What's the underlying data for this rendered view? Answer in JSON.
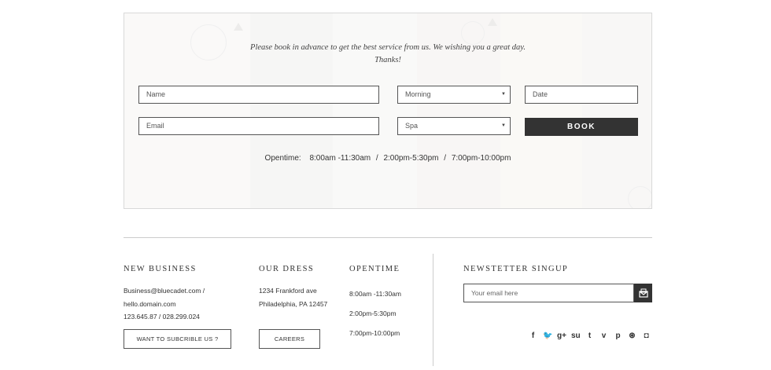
{
  "booking": {
    "intro_line1": "Please book in advance to get the best service from us. We wishing you a great day.",
    "intro_line2": "Thanks!",
    "name_placeholder": "Name",
    "email_placeholder": "Email",
    "time_value": "Morning",
    "service_value": "Spa",
    "date_placeholder": "Date",
    "book_label": "BOOK",
    "opentime_label": "Opentime:",
    "opentime_slots": [
      "8:00am -11:30am",
      "2:00pm-5:30pm",
      "7:00pm-10:00pm"
    ],
    "separator": "/"
  },
  "footer": {
    "business": {
      "title": "NEW BUSINESS",
      "lines": [
        "Business@bluecadet.com /",
        "hello.domain.com",
        "123.645.87 / 028.299.024"
      ],
      "button": "WANT TO SUBCRIBLE US ?"
    },
    "address": {
      "title": "OUR DRESS",
      "lines": [
        "1234 Frankford ave",
        "Philadelphia, PA 12457"
      ],
      "button": "CAREERS"
    },
    "opentime": {
      "title": "OPENTIME",
      "lines": [
        "8:00am -11:30am",
        "2:00pm-5:30pm",
        "7:00pm-10:00pm"
      ]
    },
    "newsletter": {
      "title": "NEWSTETTER SINGUP",
      "placeholder": "Your email here"
    },
    "socials": [
      {
        "name": "facebook-icon",
        "glyph": "f"
      },
      {
        "name": "twitter-icon",
        "glyph": "🐦"
      },
      {
        "name": "google-plus-icon",
        "glyph": "g+"
      },
      {
        "name": "stumbleupon-icon",
        "glyph": "su"
      },
      {
        "name": "tumblr-icon",
        "glyph": "t"
      },
      {
        "name": "vimeo-icon",
        "glyph": "v"
      },
      {
        "name": "pinterest-icon",
        "glyph": "p"
      },
      {
        "name": "dribbble-icon",
        "glyph": "⊛"
      },
      {
        "name": "instagram-icon",
        "glyph": "◘"
      }
    ]
  }
}
